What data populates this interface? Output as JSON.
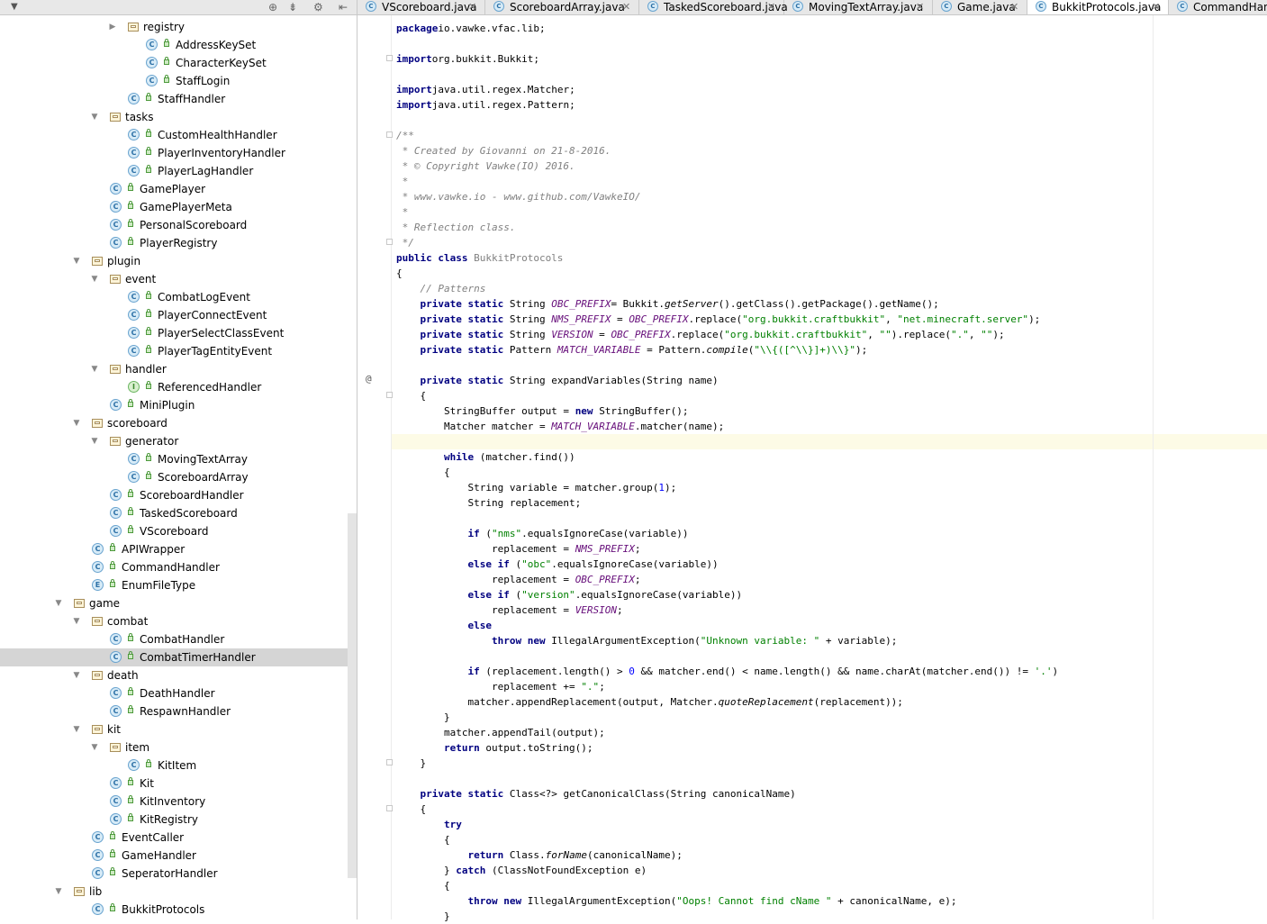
{
  "tree": [
    {
      "name": "registry",
      "kind": "folder",
      "depth": 6,
      "arrow": "right"
    },
    {
      "name": "AddressKeySet",
      "kind": "class",
      "depth": 7
    },
    {
      "name": "CharacterKeySet",
      "kind": "class",
      "depth": 7
    },
    {
      "name": "StaffLogin",
      "kind": "class",
      "depth": 7
    },
    {
      "name": "StaffHandler",
      "kind": "class",
      "depth": 6
    },
    {
      "name": "tasks",
      "kind": "folder",
      "depth": 5,
      "arrow": "down"
    },
    {
      "name": "CustomHealthHandler",
      "kind": "class",
      "depth": 6
    },
    {
      "name": "PlayerInventoryHandler",
      "kind": "class",
      "depth": 6
    },
    {
      "name": "PlayerLagHandler",
      "kind": "class",
      "depth": 6
    },
    {
      "name": "GamePlayer",
      "kind": "class",
      "depth": 5
    },
    {
      "name": "GamePlayerMeta",
      "kind": "class",
      "depth": 5
    },
    {
      "name": "PersonalScoreboard",
      "kind": "class",
      "depth": 5
    },
    {
      "name": "PlayerRegistry",
      "kind": "class",
      "depth": 5
    },
    {
      "name": "plugin",
      "kind": "folder",
      "depth": 4,
      "arrow": "down"
    },
    {
      "name": "event",
      "kind": "folder",
      "depth": 5,
      "arrow": "down"
    },
    {
      "name": "CombatLogEvent",
      "kind": "class",
      "depth": 6
    },
    {
      "name": "PlayerConnectEvent",
      "kind": "class",
      "depth": 6
    },
    {
      "name": "PlayerSelectClassEvent",
      "kind": "class",
      "depth": 6
    },
    {
      "name": "PlayerTagEntityEvent",
      "kind": "class",
      "depth": 6
    },
    {
      "name": "handler",
      "kind": "folder",
      "depth": 5,
      "arrow": "down"
    },
    {
      "name": "ReferencedHandler",
      "kind": "interface",
      "depth": 6
    },
    {
      "name": "MiniPlugin",
      "kind": "class",
      "depth": 5
    },
    {
      "name": "scoreboard",
      "kind": "folder",
      "depth": 4,
      "arrow": "down"
    },
    {
      "name": "generator",
      "kind": "folder",
      "depth": 5,
      "arrow": "down"
    },
    {
      "name": "MovingTextArray",
      "kind": "class",
      "depth": 6
    },
    {
      "name": "ScoreboardArray",
      "kind": "class",
      "depth": 6
    },
    {
      "name": "ScoreboardHandler",
      "kind": "class",
      "depth": 5
    },
    {
      "name": "TaskedScoreboard",
      "kind": "class",
      "depth": 5
    },
    {
      "name": "VScoreboard",
      "kind": "class",
      "depth": 5
    },
    {
      "name": "APIWrapper",
      "kind": "class",
      "depth": 4
    },
    {
      "name": "CommandHandler",
      "kind": "class",
      "depth": 4
    },
    {
      "name": "EnumFileType",
      "kind": "enum",
      "depth": 4
    },
    {
      "name": "game",
      "kind": "folder",
      "depth": 3,
      "arrow": "down"
    },
    {
      "name": "combat",
      "kind": "folder",
      "depth": 4,
      "arrow": "down"
    },
    {
      "name": "CombatHandler",
      "kind": "class",
      "depth": 5
    },
    {
      "name": "CombatTimerHandler",
      "kind": "class",
      "depth": 5,
      "selected": true
    },
    {
      "name": "death",
      "kind": "folder",
      "depth": 4,
      "arrow": "down"
    },
    {
      "name": "DeathHandler",
      "kind": "class",
      "depth": 5
    },
    {
      "name": "RespawnHandler",
      "kind": "class",
      "depth": 5
    },
    {
      "name": "kit",
      "kind": "folder",
      "depth": 4,
      "arrow": "down"
    },
    {
      "name": "item",
      "kind": "folder",
      "depth": 5,
      "arrow": "down"
    },
    {
      "name": "KitItem",
      "kind": "class",
      "depth": 6
    },
    {
      "name": "Kit",
      "kind": "class",
      "depth": 5
    },
    {
      "name": "KitInventory",
      "kind": "class",
      "depth": 5
    },
    {
      "name": "KitRegistry",
      "kind": "class",
      "depth": 5
    },
    {
      "name": "EventCaller",
      "kind": "class",
      "depth": 4
    },
    {
      "name": "GameHandler",
      "kind": "class",
      "depth": 4
    },
    {
      "name": "SeperatorHandler",
      "kind": "class",
      "depth": 4
    },
    {
      "name": "lib",
      "kind": "folder",
      "depth": 3,
      "arrow": "down"
    },
    {
      "name": "BukkitProtocols",
      "kind": "class",
      "depth": 4
    }
  ],
  "tabs": [
    {
      "label": "VScoreboard.java"
    },
    {
      "label": "ScoreboardArray.java"
    },
    {
      "label": "TaskedScoreboard.java"
    },
    {
      "label": "MovingTextArray.java"
    },
    {
      "label": "Game.java"
    },
    {
      "label": "BukkitProtocols.java",
      "active": true
    },
    {
      "label": "CommandHandler.java"
    }
  ],
  "code": [
    [
      [
        "kw",
        "package"
      ],
      [
        "",
        "io.vawke.vfac.lib;"
      ]
    ],
    [],
    [
      [
        "kw",
        "import"
      ],
      [
        "",
        "org.bukkit.Bukkit;"
      ]
    ],
    [],
    [
      [
        "kw",
        "import"
      ],
      [
        "",
        "java.util.regex.Matcher;"
      ]
    ],
    [
      [
        "kw",
        "import"
      ],
      [
        "",
        "java.util.regex.Pattern;"
      ]
    ],
    [],
    [
      [
        "cm",
        "/**"
      ]
    ],
    [
      [
        "cm",
        " * Created by Giovanni on 21-8-2016."
      ]
    ],
    [
      [
        "cm",
        " * © Copyright Vawke(IO) 2016."
      ]
    ],
    [
      [
        "cm",
        " *"
      ]
    ],
    [
      [
        "cm",
        " * www.vawke.io - www.github.com/VawkeIO/"
      ]
    ],
    [
      [
        "cm",
        " *"
      ]
    ],
    [
      [
        "cm",
        " * Reflection class."
      ]
    ],
    [
      [
        "cm",
        " */"
      ]
    ],
    [
      [
        "kw",
        "public class "
      ],
      [
        "gray",
        "BukkitProtocols"
      ]
    ],
    [
      [
        "",
        "{"
      ]
    ],
    [
      [
        "cm",
        "    // Patterns"
      ]
    ],
    [
      [
        "kw",
        "    private static "
      ],
      [
        "",
        "String "
      ],
      [
        "sf",
        "OBC_PREFIX"
      ],
      [
        "",
        "= Bukkit."
      ],
      [
        "it",
        "getServer"
      ],
      [
        "",
        "().getClass().getPackage().getName();"
      ]
    ],
    [
      [
        "kw",
        "    private static "
      ],
      [
        "",
        "String "
      ],
      [
        "sf",
        "NMS_PREFIX"
      ],
      [
        "",
        " = "
      ],
      [
        "sf",
        "OBC_PREFIX"
      ],
      [
        "",
        ".replace("
      ],
      [
        "str",
        "\"org.bukkit.craftbukkit\""
      ],
      [
        "",
        ", "
      ],
      [
        "str",
        "\"net.minecraft.server\""
      ],
      [
        "",
        ");"
      ]
    ],
    [
      [
        "kw",
        "    private static "
      ],
      [
        "",
        "String "
      ],
      [
        "sf",
        "VERSION"
      ],
      [
        "",
        " = "
      ],
      [
        "sf",
        "OBC_PREFIX"
      ],
      [
        "",
        ".replace("
      ],
      [
        "str",
        "\"org.bukkit.craftbukkit\""
      ],
      [
        "",
        ", "
      ],
      [
        "str",
        "\"\""
      ],
      [
        "",
        ").replace("
      ],
      [
        "str",
        "\".\""
      ],
      [
        "",
        ", "
      ],
      [
        "str",
        "\"\""
      ],
      [
        "",
        ");"
      ]
    ],
    [
      [
        "kw",
        "    private static "
      ],
      [
        "",
        "Pattern "
      ],
      [
        "sf",
        "MATCH_VARIABLE"
      ],
      [
        "",
        " = Pattern."
      ],
      [
        "it",
        "compile"
      ],
      [
        "",
        "("
      ],
      [
        "str",
        "\"\\\\{([^\\\\}]+)\\\\}\""
      ],
      [
        "",
        ");"
      ]
    ],
    [],
    [
      [
        "kw",
        "    private static "
      ],
      [
        "",
        "String expandVariables(String name)"
      ]
    ],
    [
      [
        "",
        "    {"
      ]
    ],
    [
      [
        "",
        "        StringBuffer output = "
      ],
      [
        "kw",
        "new "
      ],
      [
        "",
        "StringBuffer();"
      ]
    ],
    [
      [
        "",
        "        Matcher matcher = "
      ],
      [
        "sf",
        "MATCH_VARIABLE"
      ],
      [
        "",
        ".matcher(name);"
      ]
    ],
    [],
    [
      [
        "kw",
        "        while "
      ],
      [
        "",
        "(matcher.find())"
      ]
    ],
    [
      [
        "",
        "        {"
      ]
    ],
    [
      [
        "",
        "            String variable = matcher.group("
      ],
      [
        "num",
        "1"
      ],
      [
        "",
        ");"
      ]
    ],
    [
      [
        "",
        "            String replacement;"
      ]
    ],
    [],
    [
      [
        "kw",
        "            if "
      ],
      [
        "",
        "("
      ],
      [
        "str",
        "\"nms\""
      ],
      [
        "",
        ".equalsIgnoreCase(variable))"
      ]
    ],
    [
      [
        "",
        "                replacement = "
      ],
      [
        "sf",
        "NMS_PREFIX"
      ],
      [
        "",
        ";"
      ]
    ],
    [
      [
        "kw",
        "            else if "
      ],
      [
        "",
        "("
      ],
      [
        "str",
        "\"obc\""
      ],
      [
        "",
        ".equalsIgnoreCase(variable))"
      ]
    ],
    [
      [
        "",
        "                replacement = "
      ],
      [
        "sf",
        "OBC_PREFIX"
      ],
      [
        "",
        ";"
      ]
    ],
    [
      [
        "kw",
        "            else if "
      ],
      [
        "",
        "("
      ],
      [
        "str",
        "\"version\""
      ],
      [
        "",
        ".equalsIgnoreCase(variable))"
      ]
    ],
    [
      [
        "",
        "                replacement = "
      ],
      [
        "sf",
        "VERSION"
      ],
      [
        "",
        ";"
      ]
    ],
    [
      [
        "kw",
        "            else"
      ]
    ],
    [
      [
        "kw",
        "                throw new "
      ],
      [
        "",
        "IllegalArgumentException("
      ],
      [
        "str",
        "\"Unknown variable: \""
      ],
      [
        "",
        " + variable);"
      ]
    ],
    [],
    [
      [
        "kw",
        "            if "
      ],
      [
        "",
        "(replacement.length() > "
      ],
      [
        "num",
        "0"
      ],
      [
        "",
        " && matcher.end() < name.length() && name.charAt(matcher.end()) != "
      ],
      [
        "str",
        "'.'"
      ],
      [
        "",
        ")"
      ]
    ],
    [
      [
        "",
        "                replacement += "
      ],
      [
        "str",
        "\".\""
      ],
      [
        "",
        ";"
      ]
    ],
    [
      [
        "",
        "            matcher.appendReplacement(output, Matcher."
      ],
      [
        "it",
        "quoteReplacement"
      ],
      [
        "",
        "(replacement));"
      ]
    ],
    [
      [
        "",
        "        }"
      ]
    ],
    [
      [
        "",
        "        matcher.appendTail(output);"
      ]
    ],
    [
      [
        "kw",
        "        return "
      ],
      [
        "",
        "output.toString();"
      ]
    ],
    [
      [
        "",
        "    }"
      ]
    ],
    [],
    [
      [
        "kw",
        "    private static "
      ],
      [
        "",
        "Class<?> getCanonicalClass(String canonicalName)"
      ]
    ],
    [
      [
        "",
        "    {"
      ]
    ],
    [
      [
        "kw",
        "        try"
      ]
    ],
    [
      [
        "",
        "        {"
      ]
    ],
    [
      [
        "kw",
        "            return "
      ],
      [
        "",
        "Class."
      ],
      [
        "it",
        "forName"
      ],
      [
        "",
        "(canonicalName);"
      ]
    ],
    [
      [
        "",
        "        } "
      ],
      [
        "kw",
        "catch "
      ],
      [
        "",
        "(ClassNotFoundException e)"
      ]
    ],
    [
      [
        "",
        "        {"
      ]
    ],
    [
      [
        "kw",
        "            throw new "
      ],
      [
        "",
        "IllegalArgumentException("
      ],
      [
        "str",
        "\"Oops! Cannot find cName \""
      ],
      [
        "",
        " + canonicalName, e);"
      ]
    ],
    [
      [
        "",
        "        }"
      ]
    ]
  ]
}
